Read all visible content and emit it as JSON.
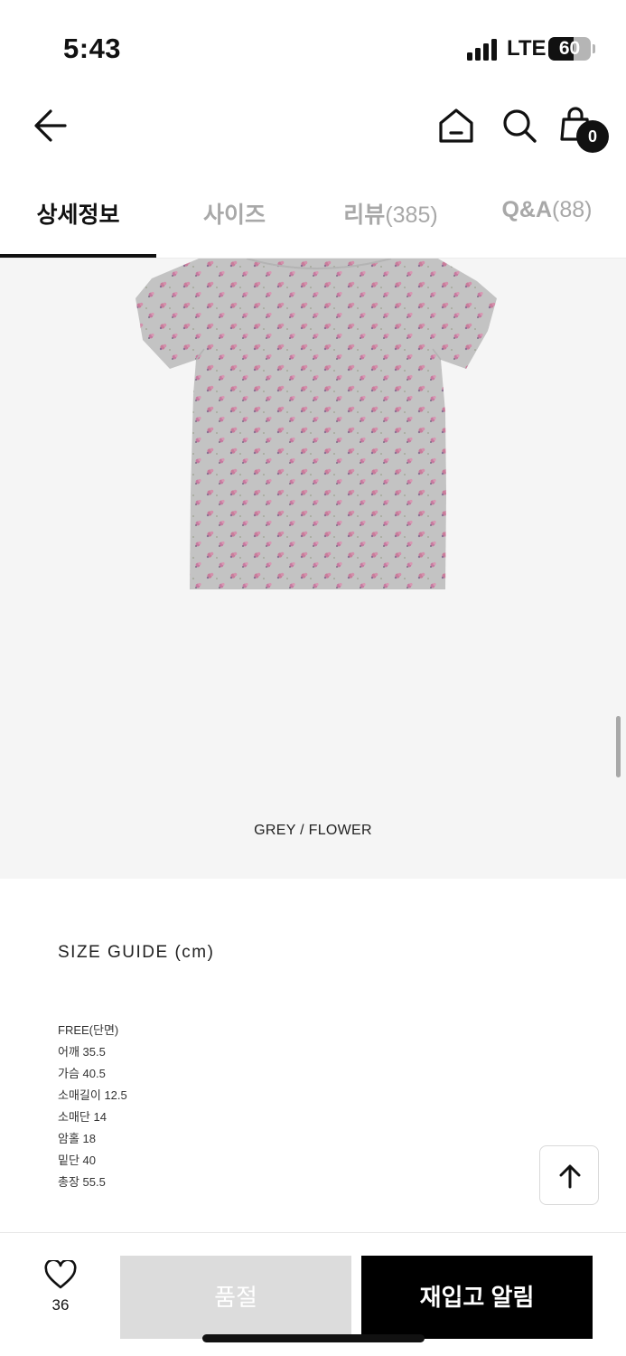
{
  "status_bar": {
    "time": "5:43",
    "network": "LTE",
    "battery_percent": "60",
    "battery_level": 0.6
  },
  "header": {
    "cart_count": "0",
    "icons": [
      "back-arrow-icon",
      "home-icon",
      "search-icon",
      "shopping-bag-icon"
    ]
  },
  "tabs": [
    {
      "label": "상세정보",
      "count": "",
      "active": true
    },
    {
      "label": "사이즈",
      "count": "",
      "active": false
    },
    {
      "label": "리뷰",
      "count": "(385)",
      "active": false
    },
    {
      "label": "Q&A",
      "count": "(88)",
      "active": false
    }
  ],
  "product": {
    "color_caption": "GREY / FLOWER",
    "image_colors": {
      "fabric": "#c4c4c4",
      "flower": "#c77a9a"
    }
  },
  "size_guide": {
    "title": "SIZE GUIDE (cm)",
    "rows": [
      "FREE(단면)",
      "어깨 35.5",
      "가슴 40.5",
      "소매길이 12.5",
      "소매단 14",
      "암홀 18",
      "밑단 40",
      "총장 55.5"
    ]
  },
  "bottom_bar": {
    "wish_count": "36",
    "soldout_label": "품절",
    "restock_label": "재입고 알림"
  }
}
